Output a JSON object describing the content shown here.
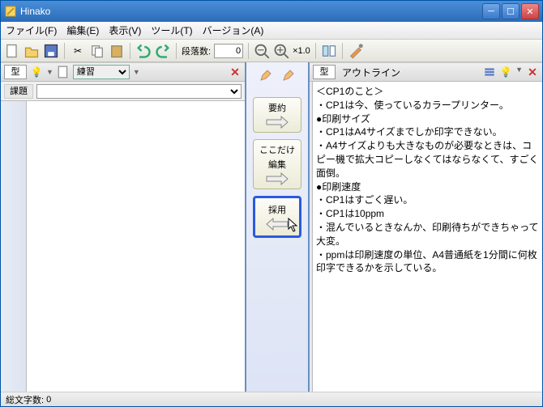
{
  "window": {
    "title": "Hinako"
  },
  "menu": {
    "file": "ファイル(F)",
    "edit": "編集(E)",
    "view": "表示(V)",
    "tool": "ツール(T)",
    "version": "バージョン(A)"
  },
  "toolbar": {
    "paragraph_label": "段落数:",
    "paragraph_value": "0",
    "zoom": "×1.0"
  },
  "left": {
    "type_label": "型",
    "mode_selected": "練習",
    "row_label": "課題",
    "row_value": ""
  },
  "mid": {
    "btn1": "要約",
    "btn2_line1": "ここだけ",
    "btn2_line2": "編集",
    "btn3": "採用"
  },
  "right": {
    "type_label": "型",
    "title": "アウトライン",
    "lines": [
      "＜CP1のこと＞",
      "・CP1は今、使っているカラープリンター。",
      "●印刷サイズ",
      "・CP1はA4サイズまでしか印字できない。",
      "・A4サイズよりも大きなものが必要なときは、コピー機で拡大コピーしなくてはならなくて、すごく面倒。",
      "●印刷速度",
      "・CP1はすごく遅い。",
      "・CP1は10ppm",
      "・混んでいるときなんか、印刷待ちができちゃって大変。",
      "・ppmは印刷速度の単位、A4普通紙を1分間に何枚印字できるかを示している。"
    ]
  },
  "status": {
    "char_label": "総文字数:",
    "char_value": "0"
  }
}
